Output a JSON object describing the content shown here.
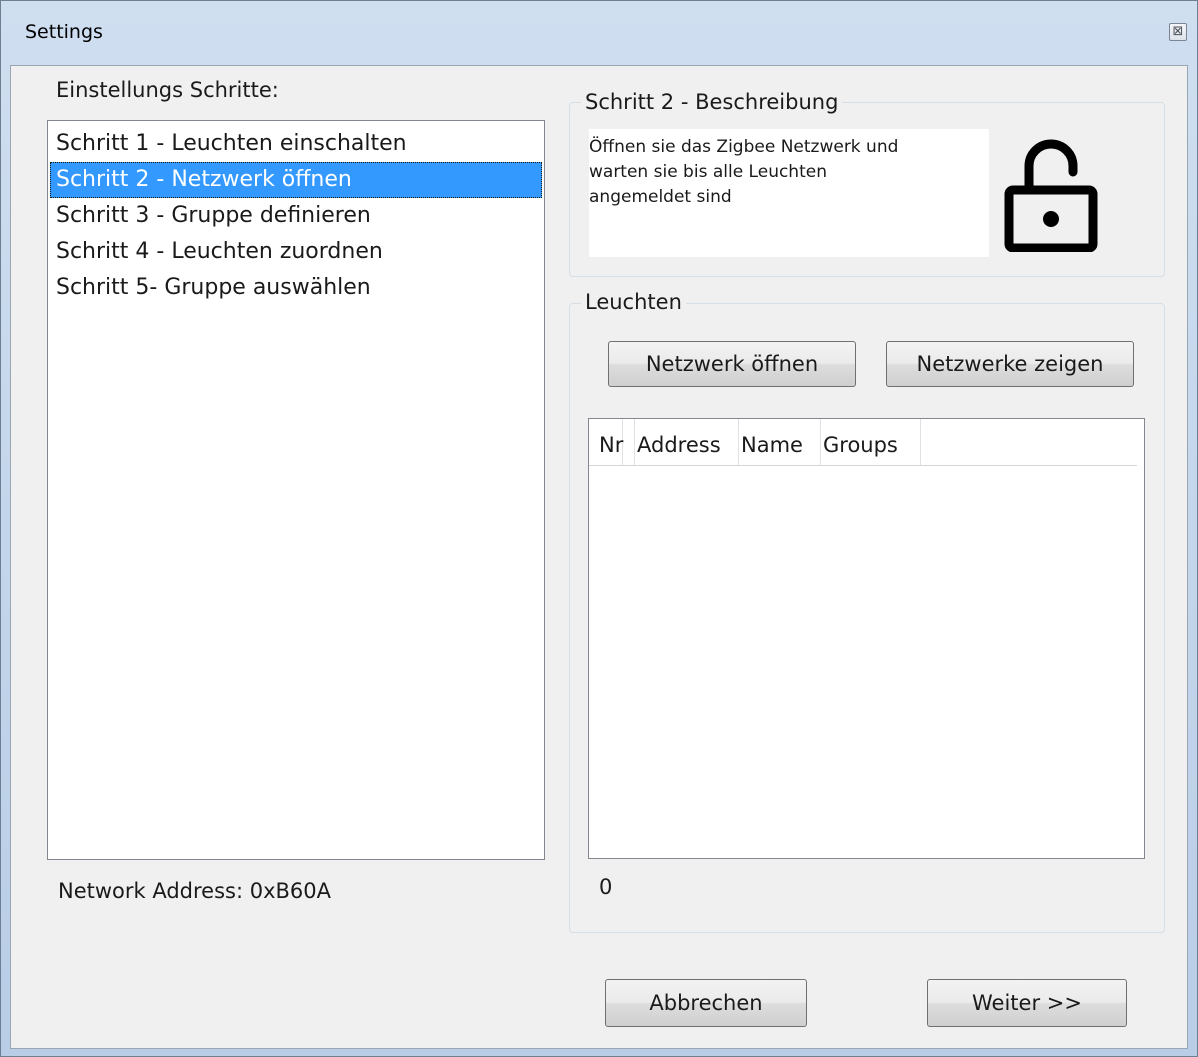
{
  "window": {
    "title": "Settings",
    "close_glyph": "⊠"
  },
  "steps": {
    "heading": "Einstellungs Schritte:",
    "items": [
      {
        "label": "Schritt 1 - Leuchten einschalten"
      },
      {
        "label": "Schritt 2 - Netzwerk öffnen",
        "selected": true
      },
      {
        "label": "Schritt 3 - Gruppe definieren"
      },
      {
        "label": "Schritt 4 - Leuchten zuordnen"
      },
      {
        "label": "Schritt 5- Gruppe auswählen"
      }
    ]
  },
  "network_address": "Network Address: 0xB60A",
  "description": {
    "group_title": "Schritt 2 - Beschreibung",
    "lines": [
      "Öffnen sie das Zigbee Netzwerk und",
      "warten sie bis alle Leuchten",
      "angemeldet sind"
    ],
    "icon": "lock-open-icon"
  },
  "lights": {
    "group_title": "Leuchten",
    "open_network_button": "Netzwerk öffnen",
    "show_networks_button": "Netzwerke zeigen",
    "columns": [
      "Nr",
      "Address",
      "Name",
      "Groups"
    ],
    "rows": [],
    "count": "0"
  },
  "footer": {
    "cancel_button": "Abbrechen",
    "next_button": "Weiter >>"
  },
  "colors": {
    "selection": "#3399ff",
    "window_background": "#f0f0f0"
  }
}
